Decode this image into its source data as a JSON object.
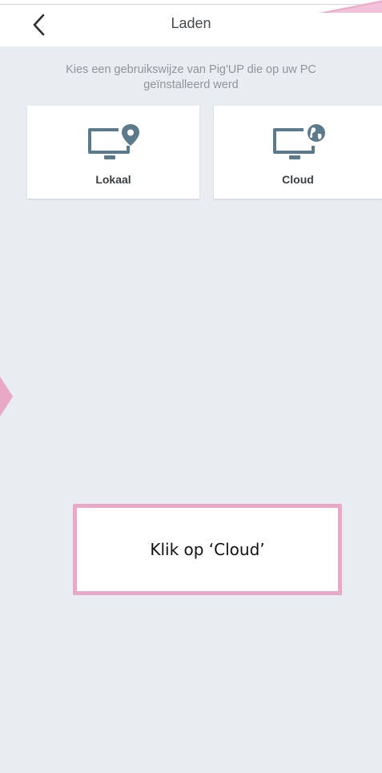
{
  "header": {
    "title": "Laden",
    "back_icon": "chevron-left-icon"
  },
  "intro": {
    "line1": "Kies een gebruikswijze van Pig'UP die op uw PC",
    "line2": "geïnstalleerd werd"
  },
  "options": [
    {
      "label": "Lokaal",
      "icon": "monitor-location-icon"
    },
    {
      "label": "Cloud",
      "icon": "monitor-globe-icon"
    }
  ],
  "callout": {
    "text": "Klik op ‘Cloud’"
  },
  "colors": {
    "background": "#e8edf1",
    "icon": "#5b7a8c",
    "callout_border": "#e8a8c6",
    "arrow": "#e8a8c6"
  }
}
